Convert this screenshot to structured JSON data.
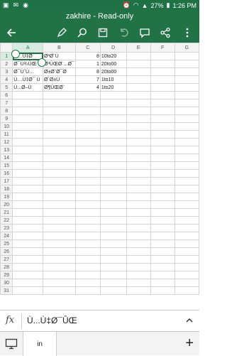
{
  "status_bar": {
    "battery": "27%",
    "time": "1:26 PM"
  },
  "title": "zakhire - Read-only",
  "columns": [
    "A",
    "B",
    "C",
    "D",
    "E",
    "F",
    "G"
  ],
  "row_count": 31,
  "cells": [
    [
      "Ù…Ù‡Ø¯",
      "Ø³Ø¨Ù",
      "8",
      "10to20"
    ],
    [
      "Ø¯Ù¾ÛŒ",
      "Ø³ÛŒØ¨...Ø¯",
      "1",
      "20to00"
    ],
    [
      "Ø¯ÙˆÙ…",
      "Ø±Ø¨Ø¯Ø",
      "8",
      "20to00"
    ],
    [
      "Ù…Ù‡Ø¯ Ù",
      "Ø´Ø±Ù",
      "7",
      "1to10"
    ],
    [
      "Ù...Ø–Ù",
      "Ø¶ÛŒØ¨",
      "4",
      "1to20"
    ]
  ],
  "formula_bar": {
    "fx_label": "fx",
    "text": "Ù...Ù‡Ø¯ÛŒ"
  },
  "sheet_tab": "in"
}
